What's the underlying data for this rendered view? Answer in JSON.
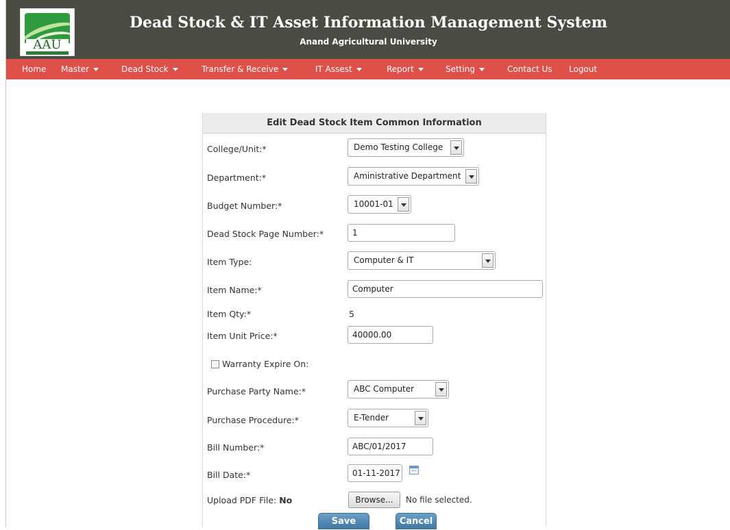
{
  "header": {
    "logo_text": "AAU",
    "title": "Dead Stock & IT Asset Information Management System",
    "subtitle": "Anand Agricultural University"
  },
  "nav": {
    "home": "Home",
    "master": "Master",
    "dead_stock": "Dead Stock",
    "transfer_receive": "Transfer & Receive",
    "it_assest": "IT Assest",
    "report": "Report",
    "setting": "Setting",
    "contact_us": "Contact Us",
    "logout": "Logout"
  },
  "form": {
    "heading": "Edit Dead Stock Item Common Information",
    "college_label": "College/Unit:*",
    "college_value": "Demo Testing College",
    "department_label": "Department:*",
    "department_value": "Aministrative Department",
    "budget_label": "Budget Number:*",
    "budget_value": "10001-01",
    "page_number_label": "Dead Stock Page Number:*",
    "page_number_value": "1",
    "item_type_label": "Item Type:",
    "item_type_value": "Computer & IT",
    "item_name_label": "Item Name:*",
    "item_name_value": "Computer",
    "item_qty_label": "Item Qty:*",
    "item_qty_value": "5",
    "unit_price_label": "Item Unit Price:*",
    "unit_price_value": "40000.00",
    "warranty_label": "Warranty Expire On:",
    "warranty_checked": false,
    "party_label": "Purchase Party Name:*",
    "party_value": "ABC Computer",
    "procedure_label": "Purchase Procedure:*",
    "procedure_value": "E-Tender",
    "bill_number_label": "Bill Number:*",
    "bill_number_value": "ABC/01/2017",
    "bill_date_label": "Bill Date:*",
    "bill_date_value": "01-11-2017",
    "upload_label": "Upload PDF File:",
    "upload_status": "No",
    "browse_label": "Browse...",
    "file_status": "No file selected.",
    "save_label": "Save",
    "cancel_label": "Cancel"
  },
  "colors": {
    "header_bg": "#4b4a43",
    "nav_bg": "#e0504b",
    "button_bg": "#3f79a7"
  }
}
